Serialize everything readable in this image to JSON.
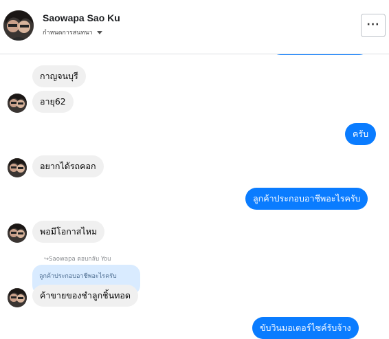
{
  "header": {
    "name": "Saowapa Sao Ku",
    "subtitle": "กำหนดการสนทนา",
    "more_label": "···"
  },
  "messages": [
    {
      "side": "in",
      "text": "กาญจนบุรี"
    },
    {
      "side": "in",
      "text": "อายุ62"
    },
    {
      "side": "out",
      "text": "ครับ"
    },
    {
      "side": "in",
      "text": "อยากได้รถคอก"
    },
    {
      "side": "out",
      "text": "ลูกค้าประกอบอาชีพอะไรครับ"
    },
    {
      "side": "in",
      "text": "พอมีโอกาสไหม"
    },
    {
      "side": "in",
      "text": "ค้าขายของชำลูกชิ้นทอด"
    },
    {
      "side": "out",
      "text": "ขับวินมอเตอร์ไซค์รับจ้าง"
    }
  ],
  "reply": {
    "label": "Saowapa ตอบกลับ You",
    "quoted": "ลูกค้าประกอบอาชีพอะไรครับ"
  },
  "colors": {
    "outgoing": "#0a7cff",
    "incoming": "#f0f0f0",
    "reply_quote": "#d9ebff"
  }
}
